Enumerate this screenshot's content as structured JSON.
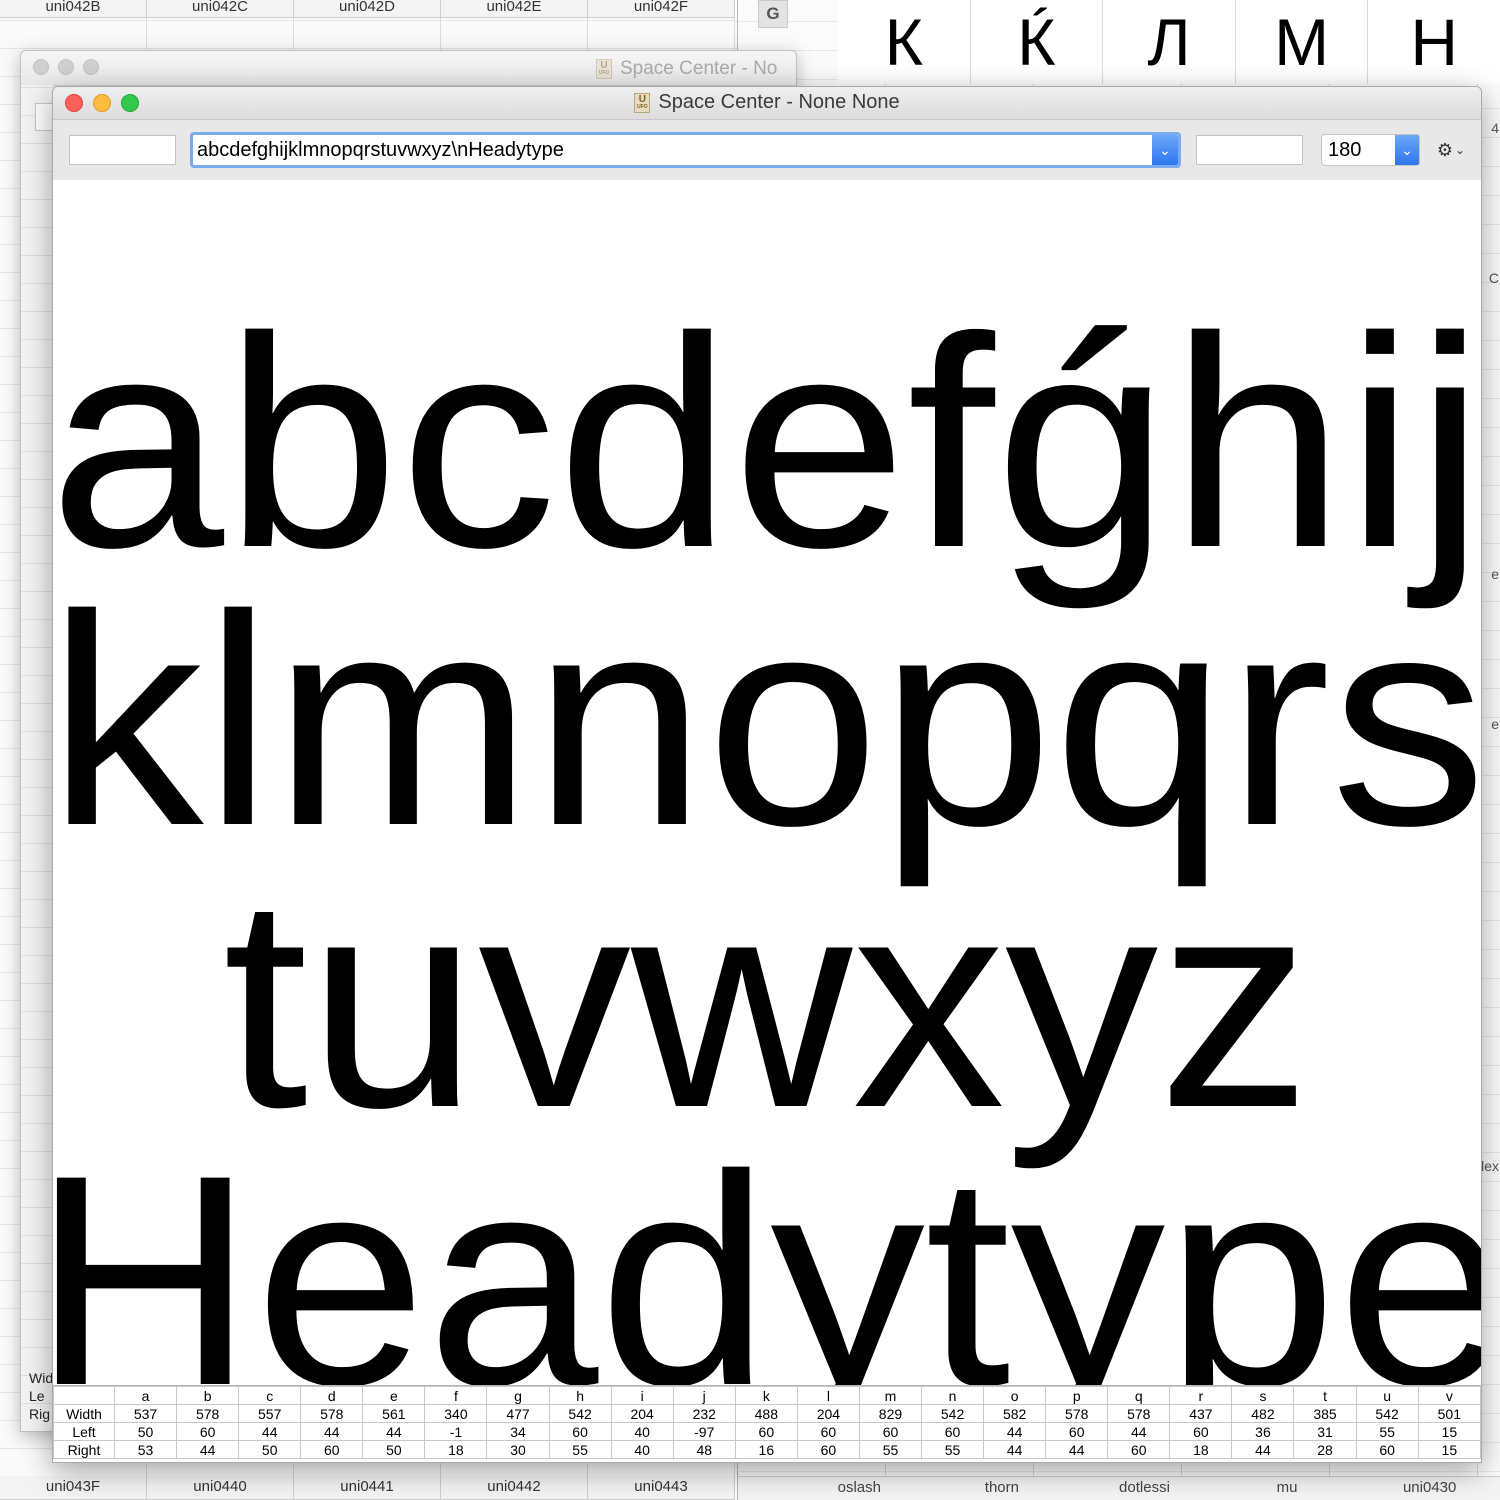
{
  "background_window": {
    "top_cells": [
      "uni042B",
      "uni042C",
      "uni042D",
      "uni042E",
      "uni042F"
    ],
    "bottom_cells": [
      "uni043F",
      "uni0440",
      "uni0441",
      "uni0442",
      "uni0443"
    ]
  },
  "glyph_window": {
    "tab_label": "G",
    "big_glyphs": [
      "К",
      "Ќ",
      "Л",
      "М",
      "Н"
    ],
    "bottom_names": [
      "oslash",
      "thorn",
      "dotlessi",
      "mu",
      "uni0430"
    ],
    "edge_labels": [
      "4",
      "C",
      "e",
      "e",
      "flex"
    ]
  },
  "behind_window": {
    "title": "Space Center - No",
    "row_labels": [
      "Wid",
      "Le",
      "Rig"
    ]
  },
  "main_window": {
    "title": "Space Center - None None",
    "pre_text": "",
    "text": "abcdefghijklmnopqrstuvwxyz\\nHeadytype",
    "post_text": "",
    "size": "180",
    "preview_lines": [
      "abcdefǵhij",
      "klmnopqrs",
      "tuvwxyz",
      "Headytype"
    ]
  },
  "metrics": {
    "row_labels": [
      "Width",
      "Left",
      "Right"
    ],
    "glyphs": [
      "a",
      "b",
      "c",
      "d",
      "e",
      "f",
      "g",
      "h",
      "i",
      "j",
      "k",
      "l",
      "m",
      "n",
      "o",
      "p",
      "q",
      "r",
      "s",
      "t",
      "u",
      "v"
    ],
    "width": [
      "537",
      "578",
      "557",
      "578",
      "561",
      "340",
      "477",
      "542",
      "204",
      "232",
      "488",
      "204",
      "829",
      "542",
      "582",
      "578",
      "578",
      "437",
      "482",
      "385",
      "542",
      "501"
    ],
    "left": [
      "50",
      "60",
      "44",
      "44",
      "44",
      "-1",
      "34",
      "60",
      "40",
      "-97",
      "60",
      "60",
      "60",
      "60",
      "44",
      "60",
      "44",
      "60",
      "36",
      "31",
      "55",
      "15"
    ],
    "right": [
      "53",
      "44",
      "50",
      "60",
      "50",
      "18",
      "30",
      "55",
      "40",
      "48",
      "16",
      "60",
      "55",
      "55",
      "44",
      "44",
      "60",
      "18",
      "44",
      "28",
      "60",
      "15"
    ]
  },
  "icons": {
    "ufo_document": "ufo-document-icon",
    "combo_arrow": "chevron-down-icon",
    "gear": "gear-icon"
  },
  "colors": {
    "close": "#fc605c",
    "minimize": "#fdbc40",
    "maximize": "#34c84a",
    "focus_ring": "#7aaaf0",
    "accent": "#2f76ef"
  }
}
